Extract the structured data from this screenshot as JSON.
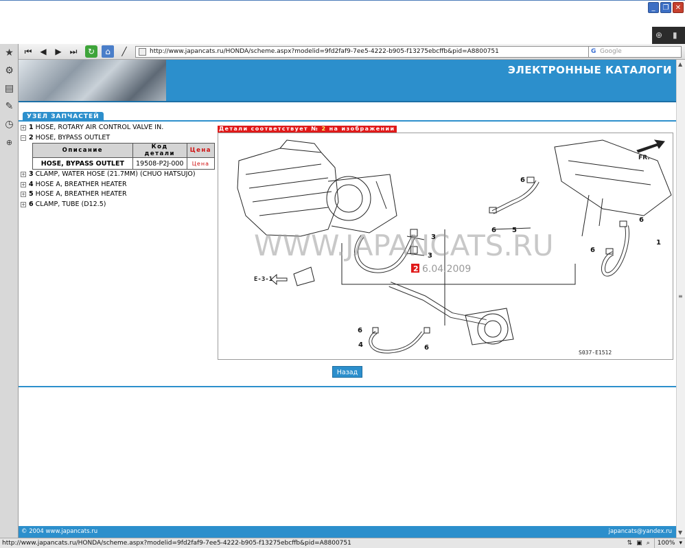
{
  "browser": {
    "url": "http://www.japancats.ru/HONDA/scheme.aspx?modelid=9fd2faf9-7ee5-4222-b905-f13275ebcffb&pid=A8800751",
    "search_placeholder": "Google",
    "status_url": "http://www.japancats.ru/HONDA/scheme.aspx?modelid=9fd2faf9-7ee5-4222-b905-f13275ebcffb&pid=A8800751",
    "zoom": "100%"
  },
  "banner": {
    "title": "ЭЛЕКТРОННЫЕ КАТАЛОГИ"
  },
  "section": {
    "tab_label": "УЗЕЛ ЗАПЧАСТЕЙ"
  },
  "parts": [
    {
      "num": "1",
      "name": "HOSE, ROTARY AIR CONTROL VALVE IN.",
      "toggle": "+"
    },
    {
      "num": "2",
      "name": "HOSE, BYPASS OUTLET",
      "toggle": "−"
    },
    {
      "num": "3",
      "name": "CLAMP, WATER HOSE (21.7MM) (CHUO HATSUJO)",
      "toggle": "+"
    },
    {
      "num": "4",
      "name": "HOSE A, BREATHER HEATER",
      "toggle": "+"
    },
    {
      "num": "5",
      "name": "HOSE A, BREATHER HEATER",
      "toggle": "+"
    },
    {
      "num": "6",
      "name": "CLAMP, TUBE (D12.5)",
      "toggle": "+"
    }
  ],
  "detail_table": {
    "headers": {
      "description": "Описание",
      "code": "Код детали",
      "price": "Цена"
    },
    "row": {
      "description": "HOSE, BYPASS OUTLET",
      "code": "19508-P2J-000",
      "price": "Цена"
    }
  },
  "note": {
    "text_before": "Детали соответствует №",
    "num": "2",
    "text_after": "на изображении"
  },
  "diagram": {
    "watermark": "WWW.JAPANCATS.RU",
    "date": "6.04.2009",
    "highlight_label": "2",
    "ref_label": "E-3-1",
    "fr_label": "FR.",
    "code": "S037-E1512",
    "callouts": [
      "1",
      "3",
      "3",
      "4",
      "5",
      "6",
      "6",
      "6",
      "6",
      "6",
      "6"
    ]
  },
  "buttons": {
    "back": "Назад"
  },
  "footer": {
    "left": "© 2004 www.japancats.ru",
    "right": "japancats@yandex.ru"
  }
}
